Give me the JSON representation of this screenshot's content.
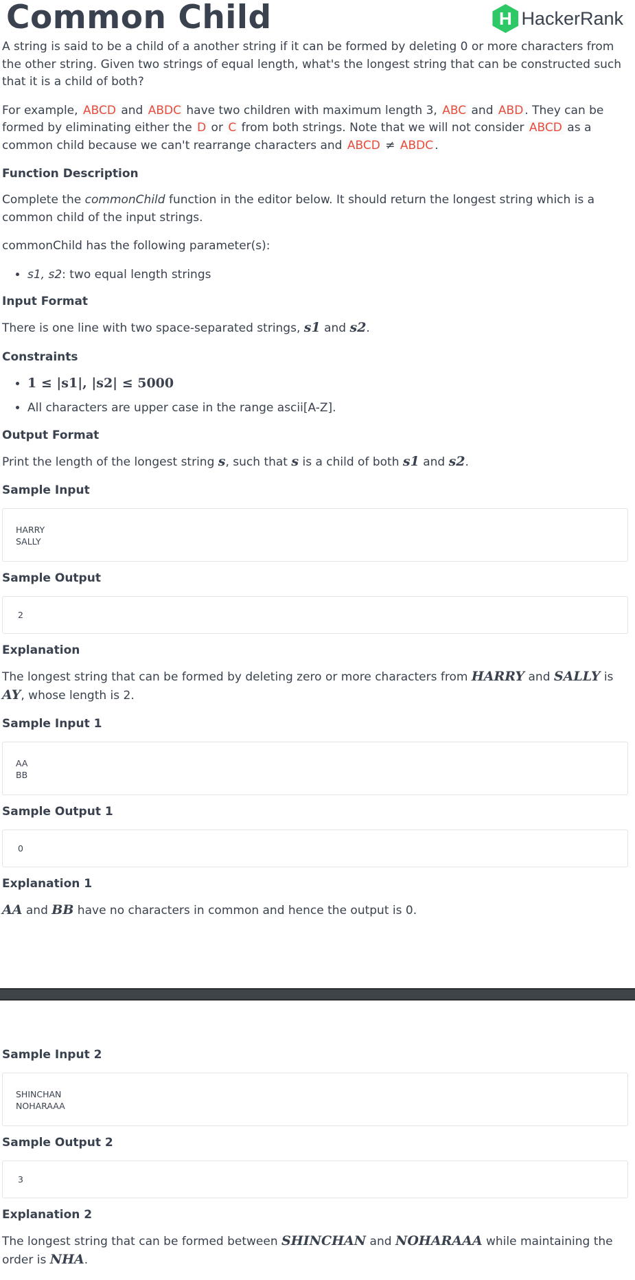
{
  "header": {
    "title": "Common Child",
    "logo_text": "HackerRank",
    "logo_letter": "H"
  },
  "intro": {
    "p1": "A string is said to be a child of a another string if it can be formed by deleting 0 or more characters from the other string. Given two strings of equal length, what's the longest string that can be constructed such that it is a child of both?",
    "example": {
      "t1": "For example, ",
      "c1": "ABCD",
      "t2": " and ",
      "c2": "ABDC",
      "t3": " have two children with maximum length 3, ",
      "c3": "ABC",
      "t4": " and ",
      "c4": "ABD",
      "t5": ". They can be formed by eliminating either the ",
      "c5": "D",
      "t6": " or ",
      "c6": "C",
      "t7": " from both strings. Note that we will not consider ",
      "c7": "ABCD",
      "t8": " as a common child because we can't rearrange characters and ",
      "c8": "ABCD",
      "neq": " ≠ ",
      "c9": "ABDC",
      "t9": "."
    }
  },
  "function_description": {
    "heading": "Function Description",
    "t1": "Complete the ",
    "fn": "commonChild",
    "t2": " function in the editor below. It should return the longest string which is a common child of the input strings.",
    "params_intro": "commonChild has the following parameter(s):",
    "param_name": "s1, s2",
    "param_desc": ": two equal length strings"
  },
  "input_format": {
    "heading": "Input Format",
    "t1": "There is one line with two space-separated strings, ",
    "m1": "s1",
    "t2": " and ",
    "m2": "s2",
    "t3": "."
  },
  "constraints": {
    "heading": "Constraints",
    "c1": "1 ≤ |s1|, |s2| ≤ 5000",
    "c2": "All characters are upper case in the range ascii[A-Z]."
  },
  "output_format": {
    "heading": "Output Format",
    "t1": "Print the length of the longest string ",
    "m1": "s",
    "t2": ", such that ",
    "m2": "s",
    "t3": " is a child of both ",
    "m3": "s1",
    "t4": " and ",
    "m4": "s2",
    "t5": "."
  },
  "sample0": {
    "input_heading": "Sample Input",
    "input_line1": "HARRY",
    "input_line2": "SALLY",
    "output_heading": "Sample Output",
    "output": "2",
    "explanation_heading": "Explanation",
    "e1": "The longest string that can be formed by deleting zero or more characters from ",
    "m1": "HARRY",
    "e2": " and ",
    "m2": "SALLY",
    "e3": " is ",
    "m3": "AY",
    "e4": ", whose length is 2."
  },
  "sample1": {
    "input_heading": "Sample Input 1",
    "input_line1": "AA",
    "input_line2": "BB",
    "output_heading": "Sample Output 1",
    "output": "0",
    "explanation_heading": "Explanation 1",
    "m1": "AA",
    "e1": " and ",
    "m2": "BB",
    "e2": " have no characters in common and hence the output is 0."
  },
  "sample2": {
    "input_heading": "Sample Input 2",
    "input_line1": "SHINCHAN",
    "input_line2": "NOHARAAA",
    "output_heading": "Sample Output 2",
    "output": "3",
    "explanation_heading": "Explanation 2",
    "e1": "The longest string that can be formed between ",
    "m1": "SHINCHAN",
    "e2": " and ",
    "m2": "NOHARAAA",
    "e3": " while maintaining the order is ",
    "m3": "NHA",
    "e4": "."
  },
  "colors": {
    "text": "#39424e",
    "code_highlight": "#e74c3c",
    "brand_green": "#2ec866",
    "divider": "#3f4448"
  }
}
